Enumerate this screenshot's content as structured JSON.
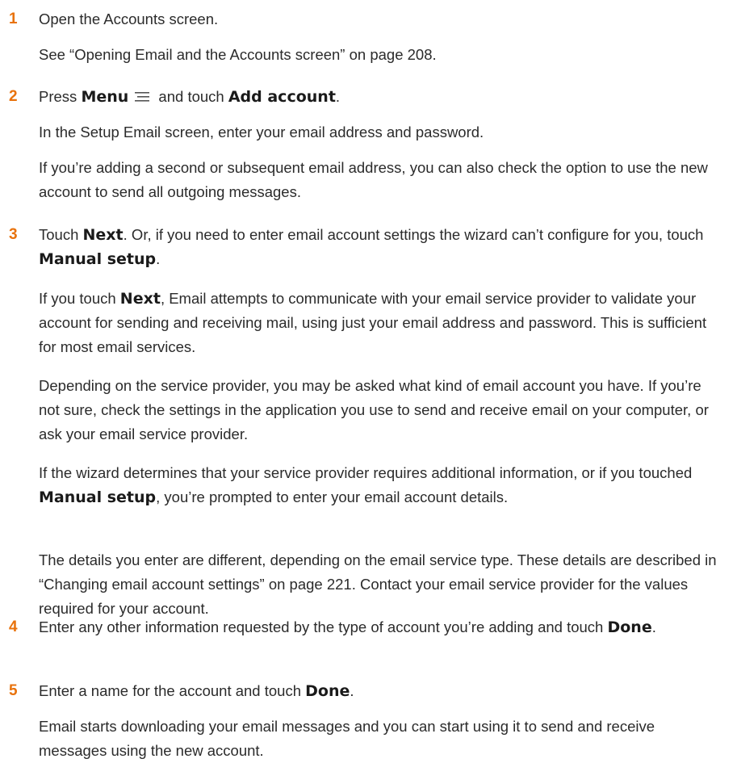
{
  "steps": [
    {
      "number": "1",
      "lines": {
        "main": "Open the Accounts screen.",
        "sub1": "See “Opening Email and the Accounts screen” on page 208."
      }
    },
    {
      "number": "2",
      "main": {
        "pre": "Press ",
        "menu": "Menu",
        "mid": " and touch ",
        "add_account": "Add account",
        "end": "."
      },
      "sub1": "In the Setup Email screen, enter your email address and password.",
      "sub2": "If you’re adding a second or subsequent email address, you can also check the option to use the new account to send all outgoing messages."
    },
    {
      "number": "3",
      "main": {
        "pre": "Touch ",
        "next": "Next",
        "mid": ". Or, if you need to enter email account settings the wizard can’t configure for you, touch ",
        "manual": "Manual setup",
        "end": "."
      },
      "sub1": {
        "pre": "If you touch ",
        "next": "Next",
        "rest": ", Email attempts to communicate with your email service provider to validate your account for sending and receiving mail, using just your email address and password. This is sufficient for most email services."
      },
      "sub2": "Depending on the service provider, you may be asked what kind of email account you have. If you’re not sure, check the settings in the application you use to send and receive email on your computer, or ask your email service provider.",
      "sub3": {
        "pre": "If the wizard determines that your service provider requires additional information, or if you touched ",
        "manual": "Manual setup",
        "rest": ", you’re prompted to enter your email account details."
      },
      "sub4": "The details you enter are different, depending on the email service type. These details are described in “Changing email account settings” on page 221. Contact your email service provider for the values required for your account."
    },
    {
      "number": "4",
      "main": {
        "pre": "Enter any other information requested by the type of account you’re adding and touch ",
        "done": "Done",
        "end": "."
      }
    },
    {
      "number": "5",
      "main": {
        "pre": "Enter a name for the account and touch ",
        "done": "Done",
        "end": "."
      },
      "sub1": "Email starts downloading your email messages and you can start using it to send and receive messages using the new account."
    }
  ],
  "icons": {
    "menu": "menu-icon"
  },
  "colors": {
    "step_number": "#e8720c",
    "text": "#2b2b2b"
  }
}
